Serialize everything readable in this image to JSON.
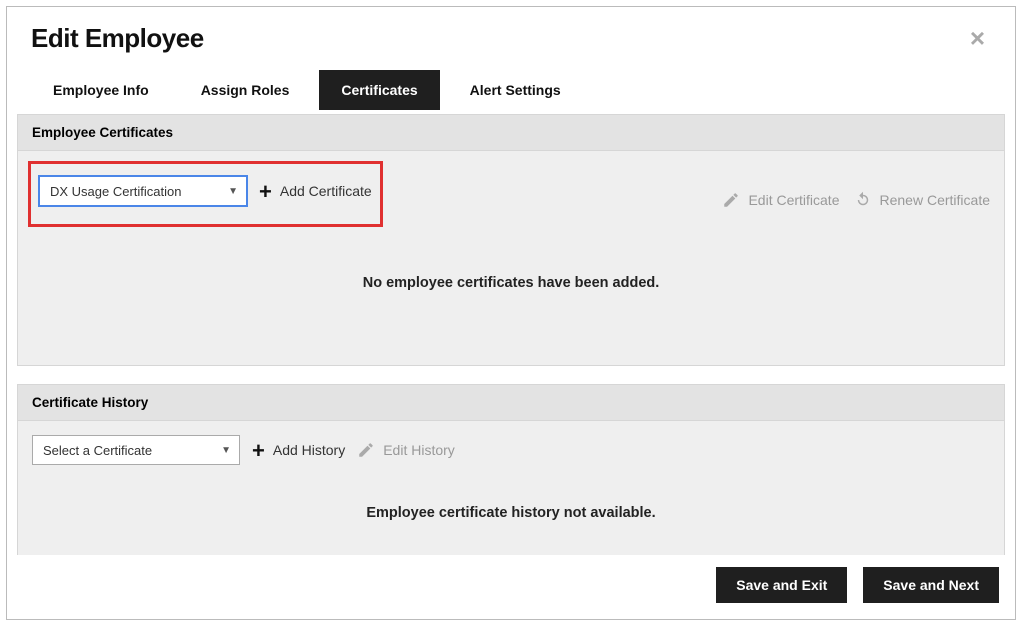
{
  "modal": {
    "title": "Edit Employee"
  },
  "tabs": {
    "items": [
      {
        "label": "Employee Info",
        "active": false
      },
      {
        "label": "Assign Roles",
        "active": false
      },
      {
        "label": "Certificates",
        "active": true
      },
      {
        "label": "Alert Settings",
        "active": false
      }
    ]
  },
  "certificates_panel": {
    "header": "Employee Certificates",
    "select_value": "DX Usage Certification",
    "add_label": "Add Certificate",
    "edit_label": "Edit Certificate",
    "renew_label": "Renew Certificate",
    "empty_message": "No employee certificates have been added."
  },
  "history_panel": {
    "header": "Certificate History",
    "select_value": "Select a Certificate",
    "add_label": "Add History",
    "edit_label": "Edit History",
    "empty_message": "Employee certificate history not available."
  },
  "footer": {
    "save_exit": "Save and Exit",
    "save_next": "Save and Next"
  }
}
